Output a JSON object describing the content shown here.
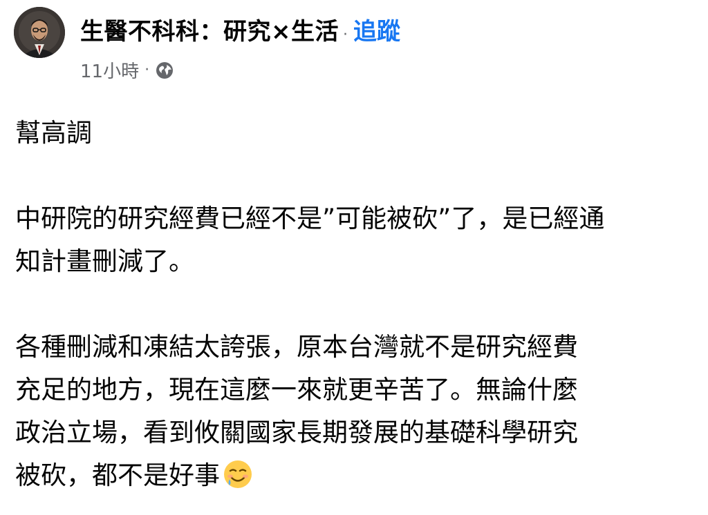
{
  "post": {
    "page_name": "生醫不科科：研究×生活",
    "separator": "·",
    "follow_label": "追蹤",
    "time": "11小時",
    "time_separator": "·",
    "audience_icon": "globe-icon",
    "paragraphs": [
      [
        "幫高調"
      ],
      [
        "中研院的研究經費已經不是”可能被砍”了，是已經通",
        "知計畫刪減了。"
      ],
      [
        "各種刪減和凍結太誇張，原本台灣就不是研究經費",
        "充足的地方，現在這麼一來就更辛苦了。無論什麼",
        "政治立場，看到攸關國家長期發展的基礎科學研究",
        "被砍，都不是好事"
      ]
    ],
    "trailing_emoji": "smiling-face-with-tear-emoji"
  },
  "colors": {
    "text": "#050505",
    "secondary": "#65676b",
    "accent": "#1877f2"
  }
}
